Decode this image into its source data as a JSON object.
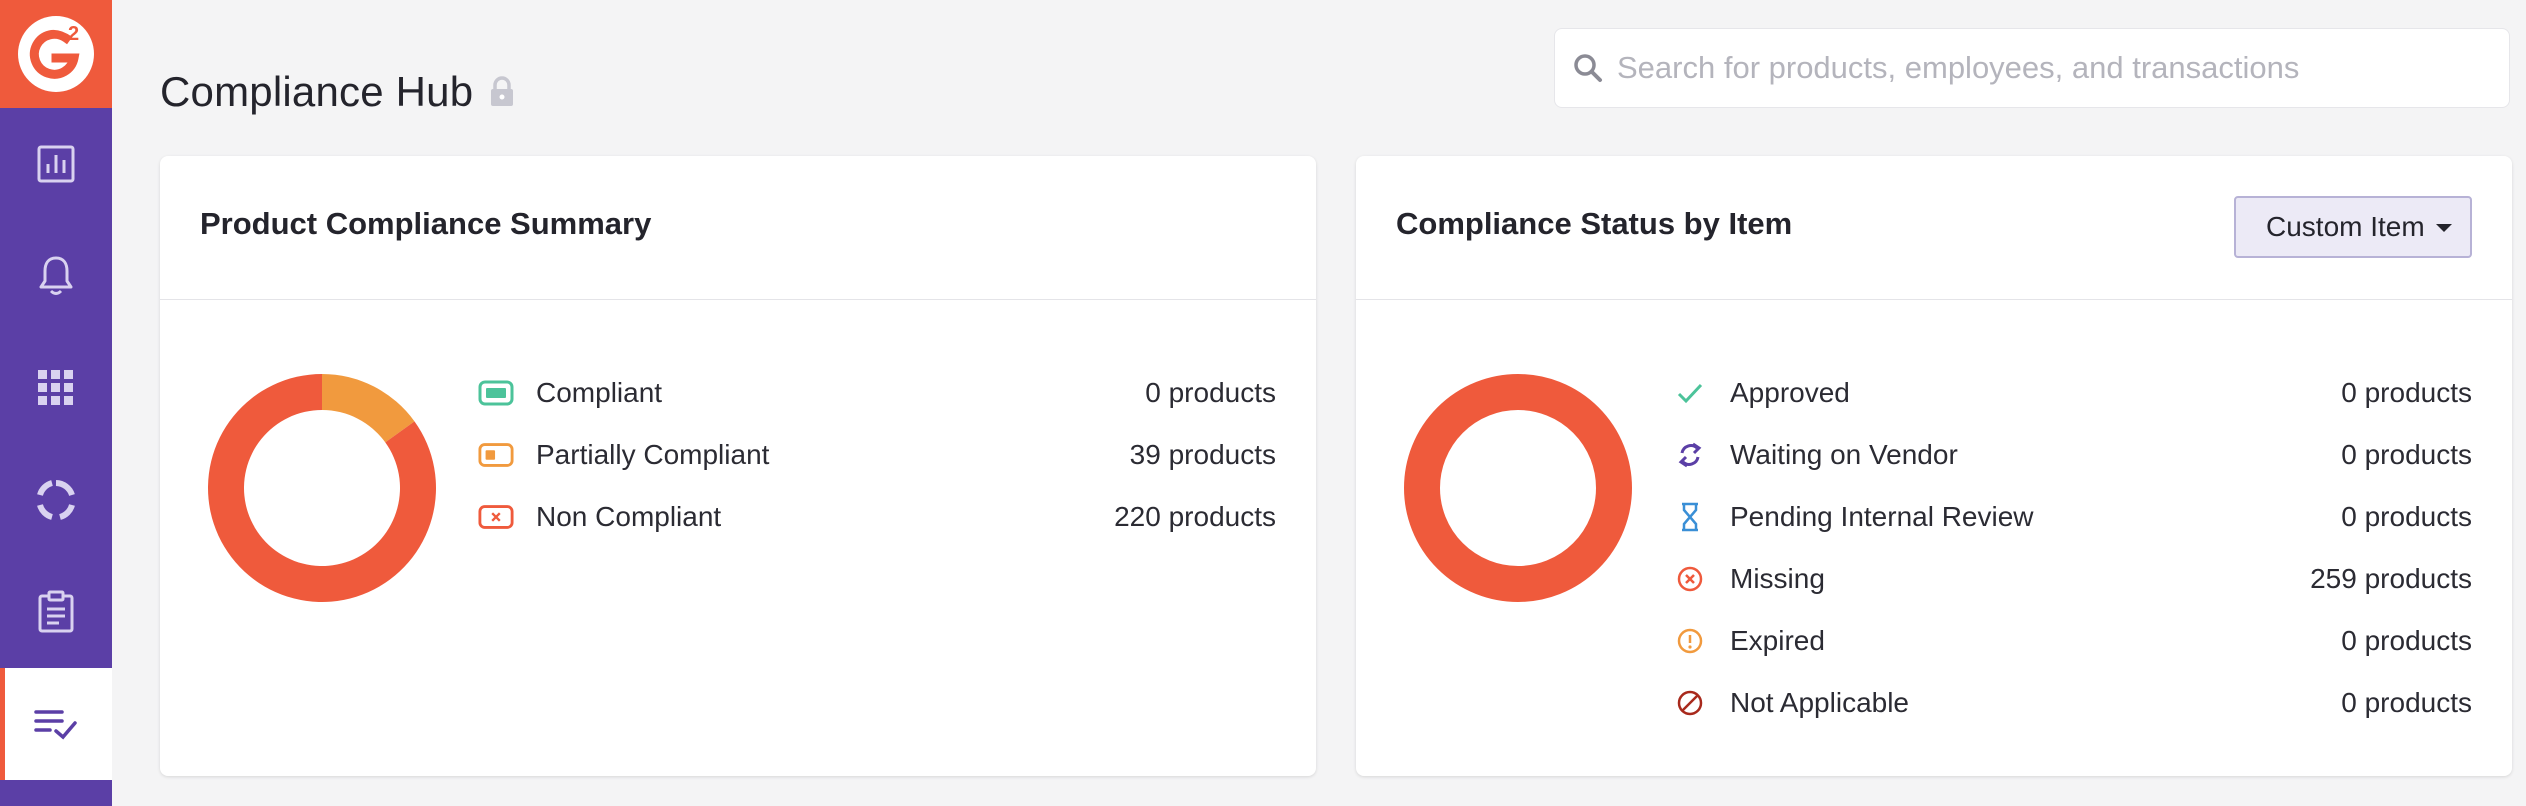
{
  "app": {
    "logo_text": "G2",
    "colors": {
      "brand_orange": "#ef5a3c",
      "sidebar_purple": "#5b3fa6",
      "compliant_green": "#4cc39a",
      "partial_orange": "#f19a3e",
      "noncompliant_red": "#ef5a3c"
    }
  },
  "sidebar": {
    "items": [
      {
        "icon": "bar-chart-icon"
      },
      {
        "icon": "bell-icon"
      },
      {
        "icon": "grid-icon"
      },
      {
        "icon": "circle-segments-icon"
      },
      {
        "icon": "clipboard-icon"
      },
      {
        "icon": "checklist-icon",
        "active": true
      }
    ]
  },
  "header": {
    "title": "Compliance Hub",
    "lock_icon": "lock-icon",
    "search_placeholder": "Search for products, employees, and transactions"
  },
  "summary_card": {
    "title": "Product Compliance Summary",
    "items": [
      {
        "label": "Compliant",
        "count": "0 products",
        "icon": "compliant-badge-icon",
        "color": "#4cc39a"
      },
      {
        "label": "Partially Compliant",
        "count": "39 products",
        "icon": "partial-badge-icon",
        "color": "#f19a3e"
      },
      {
        "label": "Non Compliant",
        "count": "220 products",
        "icon": "noncompliant-badge-icon",
        "color": "#ef5a3c"
      }
    ]
  },
  "status_card": {
    "title": "Compliance Status by Item",
    "dropdown_value": "Custom Item",
    "items": [
      {
        "label": "Approved",
        "count": "0 products",
        "icon": "checkmark-icon",
        "color": "#4cc39a"
      },
      {
        "label": "Waiting on Vendor",
        "count": "0 products",
        "icon": "sync-arrows-icon",
        "color": "#5b3fa6"
      },
      {
        "label": "Pending Internal Review",
        "count": "0 products",
        "icon": "hourglass-icon",
        "color": "#3a8fd6"
      },
      {
        "label": "Missing",
        "count": "259 products",
        "icon": "circle-x-icon",
        "color": "#ef5a3c"
      },
      {
        "label": "Expired",
        "count": "0 products",
        "icon": "circle-exclamation-icon",
        "color": "#f19a3e"
      },
      {
        "label": "Not Applicable",
        "count": "0 products",
        "icon": "circle-slash-icon",
        "color": "#a8291c"
      }
    ]
  },
  "chart_data": [
    {
      "type": "pie",
      "categories": [
        "Compliant",
        "Partially Compliant",
        "Non Compliant"
      ],
      "values": [
        0,
        39,
        220
      ],
      "colors": [
        "#4cc39a",
        "#f19a3e",
        "#ef5a3c"
      ],
      "donut": true
    },
    {
      "type": "pie",
      "categories": [
        "Approved",
        "Waiting on Vendor",
        "Pending Internal Review",
        "Missing",
        "Expired",
        "Not Applicable"
      ],
      "values": [
        0,
        0,
        0,
        259,
        0,
        0
      ],
      "colors": [
        "#4cc39a",
        "#5b3fa6",
        "#3a8fd6",
        "#ef5a3c",
        "#f19a3e",
        "#a8291c"
      ],
      "donut": true
    }
  ]
}
